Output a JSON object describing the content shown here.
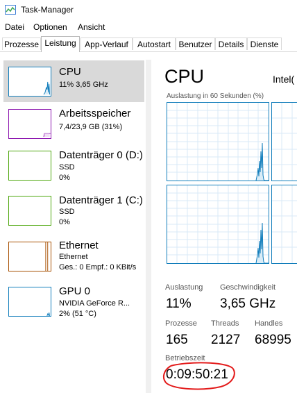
{
  "window": {
    "title": "Task-Manager"
  },
  "menu": [
    "Datei",
    "Optionen",
    "Ansicht"
  ],
  "tabs": [
    "Prozesse",
    "Leistung",
    "App-Verlauf",
    "Autostart",
    "Benutzer",
    "Details",
    "Dienste"
  ],
  "active_tab": "Leistung",
  "sidebar": {
    "items": [
      {
        "name": "CPU",
        "sub1": "11% 3,65 GHz",
        "sub2": "",
        "sub3": "",
        "color": "#117dbb",
        "selected": true
      },
      {
        "name": "Arbeitsspeicher",
        "sub1": "7,4/23,9 GB (31%)",
        "sub2": "",
        "sub3": "",
        "color": "#8b12ae",
        "selected": false
      },
      {
        "name": "Datenträger 0 (D:)",
        "sub1": "SSD",
        "sub2": "0%",
        "sub3": "",
        "color": "#4da60c",
        "selected": false
      },
      {
        "name": "Datenträger 1 (C:)",
        "sub1": "SSD",
        "sub2": "0%",
        "sub3": "",
        "color": "#4da60c",
        "selected": false
      },
      {
        "name": "Ethernet",
        "sub1": "Ethernet",
        "sub2": "Ges.: 0 Empf.: 0 KBit/s",
        "sub3": "",
        "color": "#a74f01",
        "selected": false
      },
      {
        "name": "GPU 0",
        "sub1": "NVIDIA GeForce R...",
        "sub2": "2% (51 °C)",
        "sub3": "",
        "color": "#117dbb",
        "selected": false
      }
    ]
  },
  "main": {
    "title": "CPU",
    "model": "Intel(",
    "graph_label": "Auslastung in 60 Sekunden (%)",
    "stats": {
      "auslastung_label": "Auslastung",
      "auslastung": "11%",
      "geschwindigkeit_label": "Geschwindigkeit",
      "geschwindigkeit": "3,65 GHz",
      "prozesse_label": "Prozesse",
      "prozesse": "165",
      "threads_label": "Threads",
      "threads": "2127",
      "handles_label": "Handles",
      "handles": "68995",
      "betriebszeit_label": "Betriebszeit",
      "betriebszeit": "0:09:50:21"
    }
  },
  "colors": {
    "cpu": "#117dbb",
    "highlight_ring": "#e31b1b"
  }
}
